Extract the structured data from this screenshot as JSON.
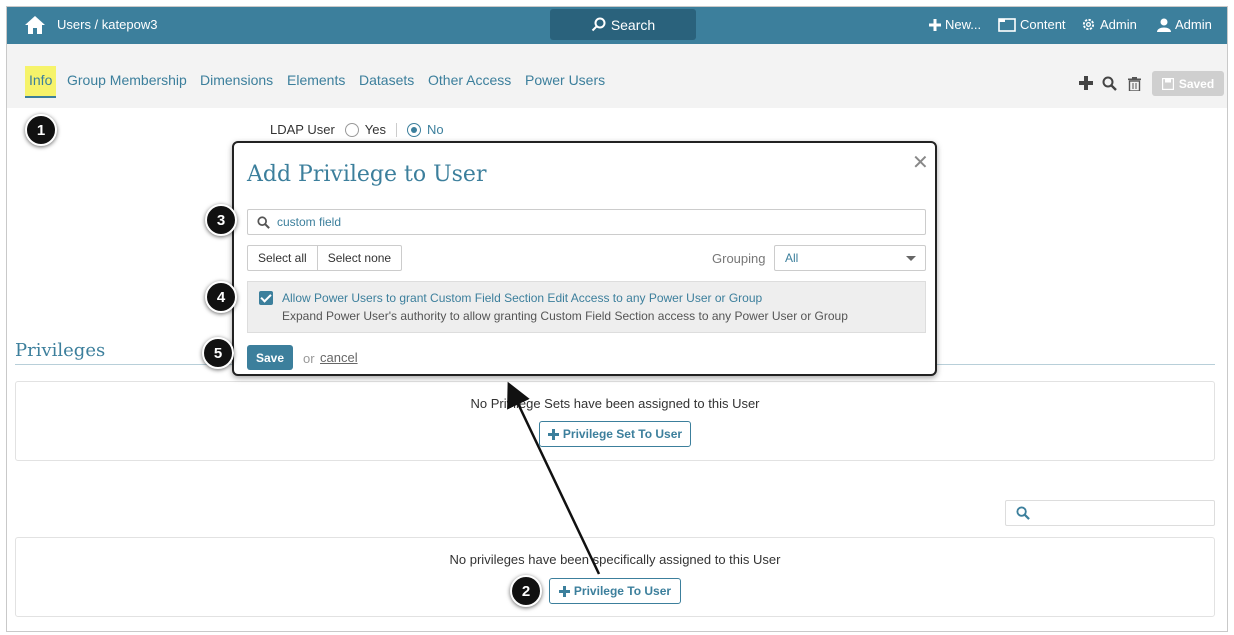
{
  "topbar": {
    "breadcrumb": "Users / katepow3",
    "search_label": "Search",
    "new_label": "New...",
    "content_label": "Content",
    "admin_label": "Admin",
    "user_label": "Admin"
  },
  "tabs": [
    {
      "label": "Info"
    },
    {
      "label": "Group Membership"
    },
    {
      "label": "Dimensions"
    },
    {
      "label": "Elements"
    },
    {
      "label": "Datasets"
    },
    {
      "label": "Other Access"
    },
    {
      "label": "Power Users"
    }
  ],
  "toolbar": {
    "saved_label": "Saved"
  },
  "ldap": {
    "label": "LDAP User",
    "option_yes": "Yes",
    "option_no": "No",
    "selected": "No"
  },
  "privileges": {
    "title": "Privileges",
    "sets_empty_msg": "No Privilege Sets have been assigned to this User",
    "add_set_label": "Privilege Set To User",
    "privs_empty_msg": "No privileges have been specifically assigned to this User",
    "add_priv_label": "Privilege To User"
  },
  "modal": {
    "title": "Add Privilege to User",
    "search_value": "custom field",
    "select_all": "Select all",
    "select_none": "Select none",
    "grouping_label": "Grouping",
    "grouping_value": "All",
    "item_name": "Allow Power Users to grant Custom Field Section Edit Access to any Power User or Group",
    "item_desc": "Expand Power User's authority to allow granting Custom Field Section access to any Power User or Group",
    "item_checked": true,
    "save_label": "Save",
    "or_label": "or",
    "cancel_label": "cancel"
  },
  "steps": [
    "1",
    "2",
    "3",
    "4",
    "5"
  ],
  "colors": {
    "accent": "#3c7f9c",
    "highlight": "#f6f36a"
  }
}
